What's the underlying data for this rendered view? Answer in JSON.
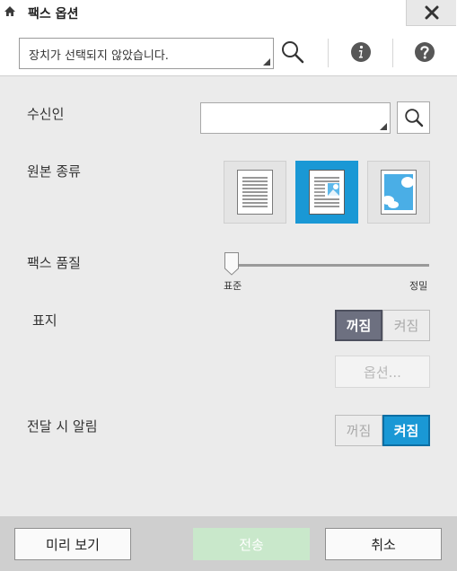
{
  "window": {
    "title": "팩스 옵션",
    "home_icon": "home-icon",
    "close_icon": "close-icon"
  },
  "toolbar": {
    "device_value": "장치가 선택되지 않았습니다.",
    "search_icon": "search-icon",
    "info_icon": "info-icon",
    "help_icon": "help-icon"
  },
  "form": {
    "recipient_label": "수신인",
    "recipient_value": "",
    "doc_type_label": "원본 종류",
    "doc_types": [
      {
        "name": "text",
        "icon": "text-document-icon",
        "selected": false
      },
      {
        "name": "mixed",
        "icon": "text-photo-document-icon",
        "selected": true
      },
      {
        "name": "photo",
        "icon": "photo-document-icon",
        "selected": false
      }
    ],
    "quality_label": "팩스 품질",
    "quality_min": "표준",
    "quality_max": "정밀",
    "quality_value": 0,
    "mark_label": "표지",
    "mark_off": "꺼짐",
    "mark_on": "켜짐",
    "mark_state": "off",
    "options_label": "옵션...",
    "notify_label": "전달 시 알림",
    "notify_off": "꺼짐",
    "notify_on": "켜짐",
    "notify_state": "on"
  },
  "footer": {
    "preview_label": "미리 보기",
    "send_label": "전송",
    "cancel_label": "취소"
  },
  "colors": {
    "accent_blue": "#1a98d5",
    "active_dark": "#6d7080",
    "send_disabled": "#c9e8cb"
  }
}
